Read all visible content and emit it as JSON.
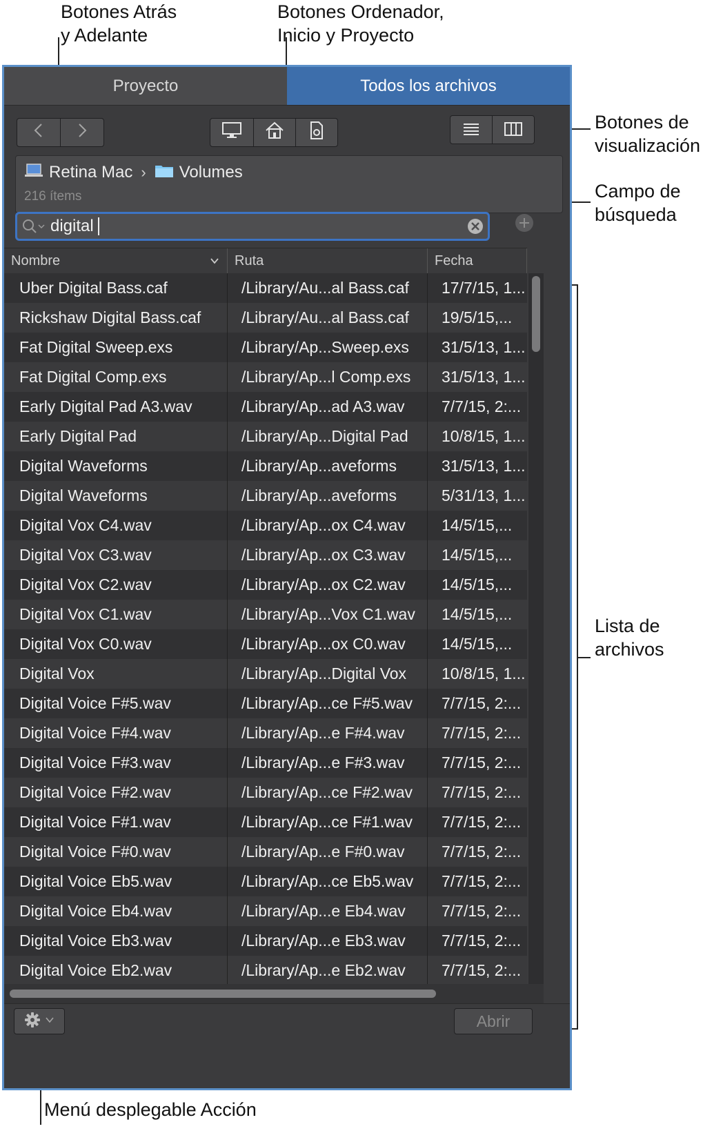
{
  "annotations": {
    "back_forward": "Botones Atrás\ny Adelante",
    "computer_home_project": "Botones Ordenador,\nInicio y Proyecto",
    "view_buttons": "Botones de\nvisualización",
    "search_field": "Campo de\nbúsqueda",
    "file_list": "Lista de\narchivos",
    "action_menu": "Menú desplegable Acción"
  },
  "tabs": [
    {
      "label": "Proyecto",
      "active": false
    },
    {
      "label": "Todos los archivos",
      "active": true
    }
  ],
  "nav": {
    "back_icon": "chevron-left-icon",
    "forward_icon": "chevron-right-icon"
  },
  "location_buttons": [
    "computer-icon",
    "home-icon",
    "project-icon"
  ],
  "view_buttons": [
    "list-view-icon",
    "column-view-icon"
  ],
  "path": {
    "computer": "Retina Mac",
    "separator": "›",
    "folder": "Volumes",
    "count": "216 ítems"
  },
  "search": {
    "value": "digital"
  },
  "columns": [
    "Nombre",
    "Ruta",
    "Fecha"
  ],
  "files": [
    {
      "name": "Uber Digital Bass.caf",
      "path": "/Library/Au...al Bass.caf",
      "date": "17/7/15, 1..."
    },
    {
      "name": "Rickshaw Digital Bass.caf",
      "path": "/Library/Au...al Bass.caf",
      "date": "19/5/15,..."
    },
    {
      "name": "Fat Digital Sweep.exs",
      "path": "/Library/Ap...Sweep.exs",
      "date": "31/5/13, 1..."
    },
    {
      "name": "Fat Digital Comp.exs",
      "path": "/Library/Ap...l Comp.exs",
      "date": "31/5/13, 1..."
    },
    {
      "name": "Early Digital Pad A3.wav",
      "path": "/Library/Ap...ad A3.wav",
      "date": "7/7/15, 2:..."
    },
    {
      "name": "Early Digital Pad",
      "path": "/Library/Ap...Digital Pad",
      "date": "10/8/15, 1..."
    },
    {
      "name": "Digital Waveforms",
      "path": "/Library/Ap...aveforms",
      "date": "31/5/13, 1..."
    },
    {
      "name": "Digital Waveforms",
      "path": "/Library/Ap...aveforms",
      "date": "5/31/13, 1..."
    },
    {
      "name": "Digital Vox C4.wav",
      "path": "/Library/Ap...ox C4.wav",
      "date": "14/5/15,..."
    },
    {
      "name": "Digital Vox C3.wav",
      "path": "/Library/Ap...ox C3.wav",
      "date": "14/5/15,..."
    },
    {
      "name": "Digital Vox C2.wav",
      "path": "/Library/Ap...ox C2.wav",
      "date": "14/5/15,..."
    },
    {
      "name": "Digital Vox C1.wav",
      "path": "/Library/Ap...Vox C1.wav",
      "date": "14/5/15,..."
    },
    {
      "name": "Digital Vox C0.wav",
      "path": "/Library/Ap...ox C0.wav",
      "date": "14/5/15,..."
    },
    {
      "name": "Digital Vox",
      "path": "/Library/Ap...Digital Vox",
      "date": "10/8/15, 1..."
    },
    {
      "name": "Digital Voice F#5.wav",
      "path": "/Library/Ap...ce F#5.wav",
      "date": "7/7/15, 2:..."
    },
    {
      "name": "Digital Voice F#4.wav",
      "path": "/Library/Ap...e F#4.wav",
      "date": "7/7/15, 2:..."
    },
    {
      "name": "Digital Voice F#3.wav",
      "path": "/Library/Ap...e F#3.wav",
      "date": "7/7/15, 2:..."
    },
    {
      "name": "Digital Voice F#2.wav",
      "path": "/Library/Ap...ce F#2.wav",
      "date": "7/7/15, 2:..."
    },
    {
      "name": "Digital Voice F#1.wav",
      "path": "/Library/Ap...ce F#1.wav",
      "date": "7/7/15, 2:..."
    },
    {
      "name": "Digital Voice F#0.wav",
      "path": "/Library/Ap...e F#0.wav",
      "date": "7/7/15, 2:..."
    },
    {
      "name": "Digital Voice Eb5.wav",
      "path": "/Library/Ap...ce Eb5.wav",
      "date": "7/7/15, 2:..."
    },
    {
      "name": "Digital Voice Eb4.wav",
      "path": "/Library/Ap...e Eb4.wav",
      "date": "7/7/15, 2:..."
    },
    {
      "name": "Digital Voice Eb3.wav",
      "path": "/Library/Ap...e Eb3.wav",
      "date": "7/7/15, 2:..."
    },
    {
      "name": "Digital Voice Eb2.wav",
      "path": "/Library/Ap...e Eb2.wav",
      "date": "7/7/15, 2:..."
    }
  ],
  "footer": {
    "action_icon": "gear-icon",
    "open_label": "Abrir"
  },
  "colors": {
    "accent": "#3d6eab",
    "window_bg": "#3b3b3d",
    "focus_ring": "#3d74c4"
  }
}
